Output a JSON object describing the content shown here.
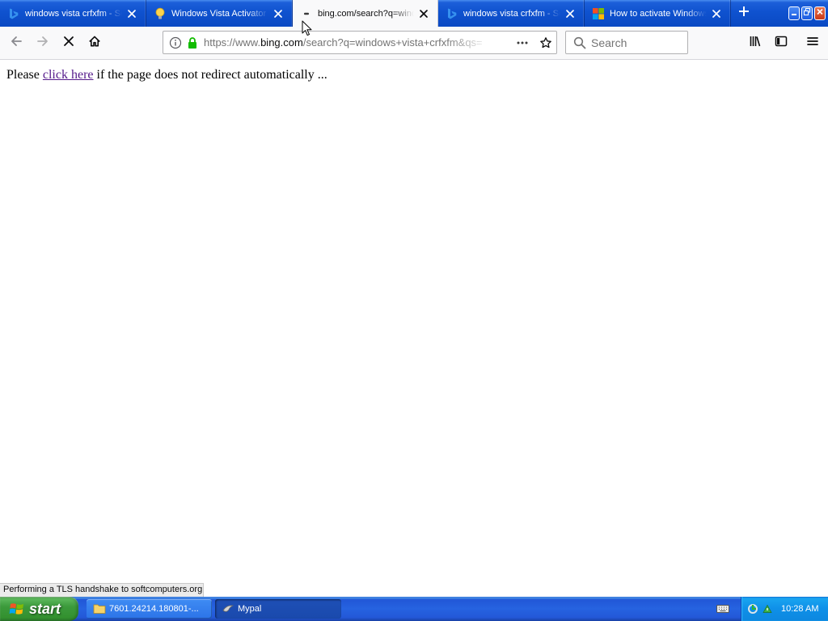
{
  "tabs": [
    {
      "label": "windows vista crfxfm - Se",
      "icon": "bing-icon",
      "active": false
    },
    {
      "label": "Windows Vista Activator -",
      "icon": "lightbulb-icon",
      "active": false
    },
    {
      "label": "bing.com/search?q=wind",
      "icon": "loading-icon",
      "active": true
    },
    {
      "label": "windows vista crfxfm - Se",
      "icon": "bing-icon",
      "active": false
    },
    {
      "label": "How to activate Windows",
      "icon": "microsoft-logo-icon",
      "active": false
    }
  ],
  "tabstrip": {
    "new_tab_icon": "plus-icon"
  },
  "window_controls": [
    "minimize-icon",
    "restore-icon",
    "close-icon"
  ],
  "navbar": {
    "buttons": [
      "back-arrow-icon",
      "forward-arrow-icon",
      "stop-icon",
      "home-icon"
    ],
    "url": {
      "prefix": "https://www.",
      "domain": "bing.com",
      "path": "/search?q=windows+vista+crfxfm&qs="
    },
    "url_icons": [
      "info-icon",
      "lock-icon",
      "page-actions-icon",
      "bookmark-star-icon"
    ],
    "search": {
      "placeholder": "Search",
      "icon": "search-icon"
    },
    "toolbar_icons": [
      "library-icon",
      "sidebar-icon",
      "menu-icon"
    ]
  },
  "page": {
    "before_link": "Please",
    "link_text": "click here",
    "after_link": "if the page does not redirect automatically ..."
  },
  "status": {
    "text": "Performing a TLS handshake to softcomputers.org..."
  },
  "taskbar": {
    "start_label": "start",
    "buttons": [
      {
        "label": "7601.24214.180801-...",
        "icon": "folder-icon",
        "active": false
      },
      {
        "label": "Mypal",
        "icon": "mypal-icon",
        "active": true
      }
    ],
    "tray_icons": [
      "keyboard-icon",
      "tray-network-icon",
      "tray-security-icon"
    ],
    "clock": "10:28 AM"
  },
  "colors": {
    "link": "#551a8b",
    "secure_lock": "#12bc00",
    "start_button": "#3c9a3c",
    "taskbar": "#245edb",
    "active_tab": "#f9f9fa"
  }
}
